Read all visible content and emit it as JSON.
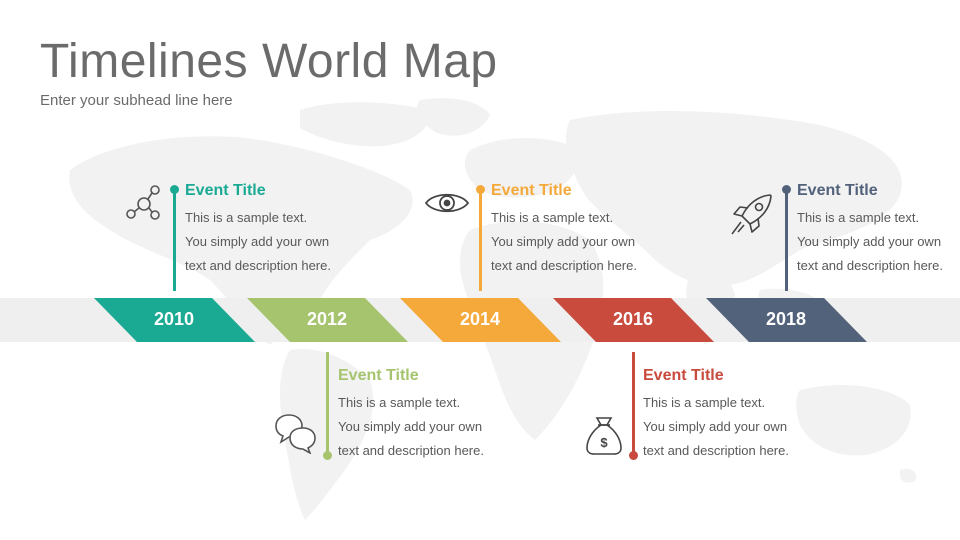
{
  "header": {
    "title": "Timelines World Map",
    "subtitle": "Enter your subhead line here"
  },
  "colors": {
    "teal": "#1aaa94",
    "green": "#a5c46d",
    "orange": "#f5a93a",
    "red": "#c94b3d",
    "slate": "#52627a",
    "band": "#efefef",
    "map": "#f2f2f2"
  },
  "timeline": {
    "years": [
      "2010",
      "2012",
      "2014",
      "2016",
      "2018"
    ]
  },
  "events": [
    {
      "title": "Event Title",
      "lines": [
        "This is a sample text.",
        "You simply add your own",
        "text and description here."
      ],
      "icon": "network-icon"
    },
    {
      "title": "Event Title",
      "lines": [
        "This is a sample text.",
        "You simply add your own",
        "text and description here."
      ],
      "icon": "chat-bubbles-icon"
    },
    {
      "title": "Event Title",
      "lines": [
        "This is a sample text.",
        "You simply add your own",
        "text and description here."
      ],
      "icon": "eye-icon"
    },
    {
      "title": "Event Title",
      "lines": [
        "This is a sample text.",
        "You simply add your own",
        "text and description here."
      ],
      "icon": "money-bag-icon"
    },
    {
      "title": "Event Title",
      "lines": [
        "This is a sample text.",
        "You simply add your own",
        "text and description here."
      ],
      "icon": "rocket-icon"
    }
  ]
}
